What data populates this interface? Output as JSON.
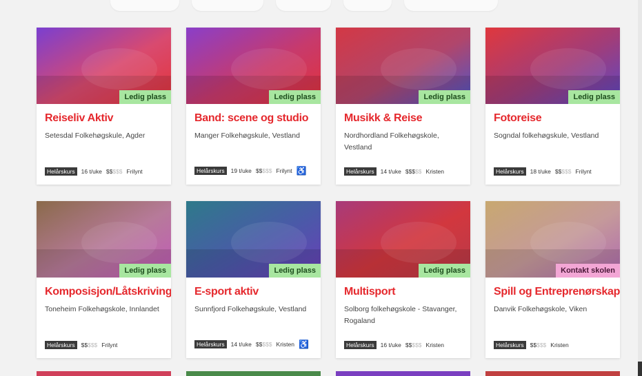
{
  "cards": [
    {
      "title": "Reiseliv Aktiv",
      "school": "Setesdal Folkehøgskule, Agder",
      "badge": "Ledig plass",
      "badge_type": "green",
      "course_type": "Helårskurs",
      "hours": "16 t/uke",
      "price_on": "$$",
      "price_off": "$$$",
      "profile": "Frilynt",
      "accessible": false,
      "accessible_icon": "",
      "colors": [
        "#7a3fd0",
        "#d94a6f",
        "#e3343a"
      ]
    },
    {
      "title": "Band: scene og studio",
      "school": "Manger Folkehøgskule, Vestland",
      "badge": "Ledig plass",
      "badge_type": "green",
      "course_type": "Helårskurs",
      "hours": "19 t/uke",
      "price_on": "$$",
      "price_off": "$$$",
      "profile": "Frilynt",
      "accessible": true,
      "accessible_icon": "♿",
      "colors": [
        "#8a3fc9",
        "#c73a6c",
        "#e2323b"
      ]
    },
    {
      "title": "Musikk & Reise",
      "school": "Nordhordland Folkehøgskole, Vestland",
      "badge": "Ledig plass",
      "badge_type": "green",
      "course_type": "Helårskurs",
      "hours": "14 t/uke",
      "price_on": "$$$",
      "price_off": "$$",
      "profile": "Kristen",
      "accessible": false,
      "accessible_icon": "",
      "colors": [
        "#d33845",
        "#b0466c",
        "#4e55c8"
      ]
    },
    {
      "title": "Fotoreise",
      "school": "Sogndal folkehøgskule, Vestland",
      "badge": "Ledig plass",
      "badge_type": "green",
      "course_type": "Helårskurs",
      "hours": "18 t/uke",
      "price_on": "$$",
      "price_off": "$$$",
      "profile": "Frilynt",
      "accessible": false,
      "accessible_icon": "",
      "colors": [
        "#e0383d",
        "#a03d7a",
        "#5d48c4"
      ]
    },
    {
      "title": "Komposisjon/Låtskriving",
      "school": "Toneheim Folkehøgskole, Innlandet",
      "badge": "Ledig plass",
      "badge_type": "green",
      "course_type": "Helårskurs",
      "hours": "",
      "price_on": "$$",
      "price_off": "$$$",
      "profile": "Frilynt",
      "accessible": false,
      "accessible_icon": "",
      "colors": [
        "#8a6a4a",
        "#b77a9a",
        "#c25ab9"
      ]
    },
    {
      "title": "E-sport aktiv",
      "school": "Sunnfjord Folkehøgskule, Vestland",
      "badge": "Ledig plass",
      "badge_type": "green",
      "course_type": "Helårskurs",
      "hours": "14 t/uke",
      "price_on": "$$",
      "price_off": "$$$",
      "profile": "Kristen",
      "accessible": true,
      "accessible_icon": "♿",
      "colors": [
        "#2e7a8a",
        "#4a5aa8",
        "#6a3fb8"
      ]
    },
    {
      "title": "Multisport",
      "school": "Solborg folkehøgskole - Stavanger, Rogaland",
      "badge": "Ledig plass",
      "badge_type": "green",
      "course_type": "Helårskurs",
      "hours": "16 t/uke",
      "price_on": "$$",
      "price_off": "$$$",
      "profile": "Kristen",
      "accessible": false,
      "accessible_icon": "",
      "colors": [
        "#a83a7a",
        "#d2373e",
        "#b83a4a"
      ]
    },
    {
      "title": "Spill og Entreprenørskap",
      "school": "Danvik Folkehøgskole, Viken",
      "badge": "Kontakt skolen",
      "badge_type": "pink",
      "course_type": "Helårskurs",
      "hours": "",
      "price_on": "$$",
      "price_off": "$$$",
      "profile": "Kristen",
      "accessible": false,
      "accessible_icon": "",
      "colors": [
        "#c8a870",
        "#c59a9a",
        "#b06ab0"
      ]
    }
  ],
  "bottom_colors": [
    "#d0405a",
    "#4a8a4a",
    "#7a3fc0",
    "#c04040"
  ]
}
